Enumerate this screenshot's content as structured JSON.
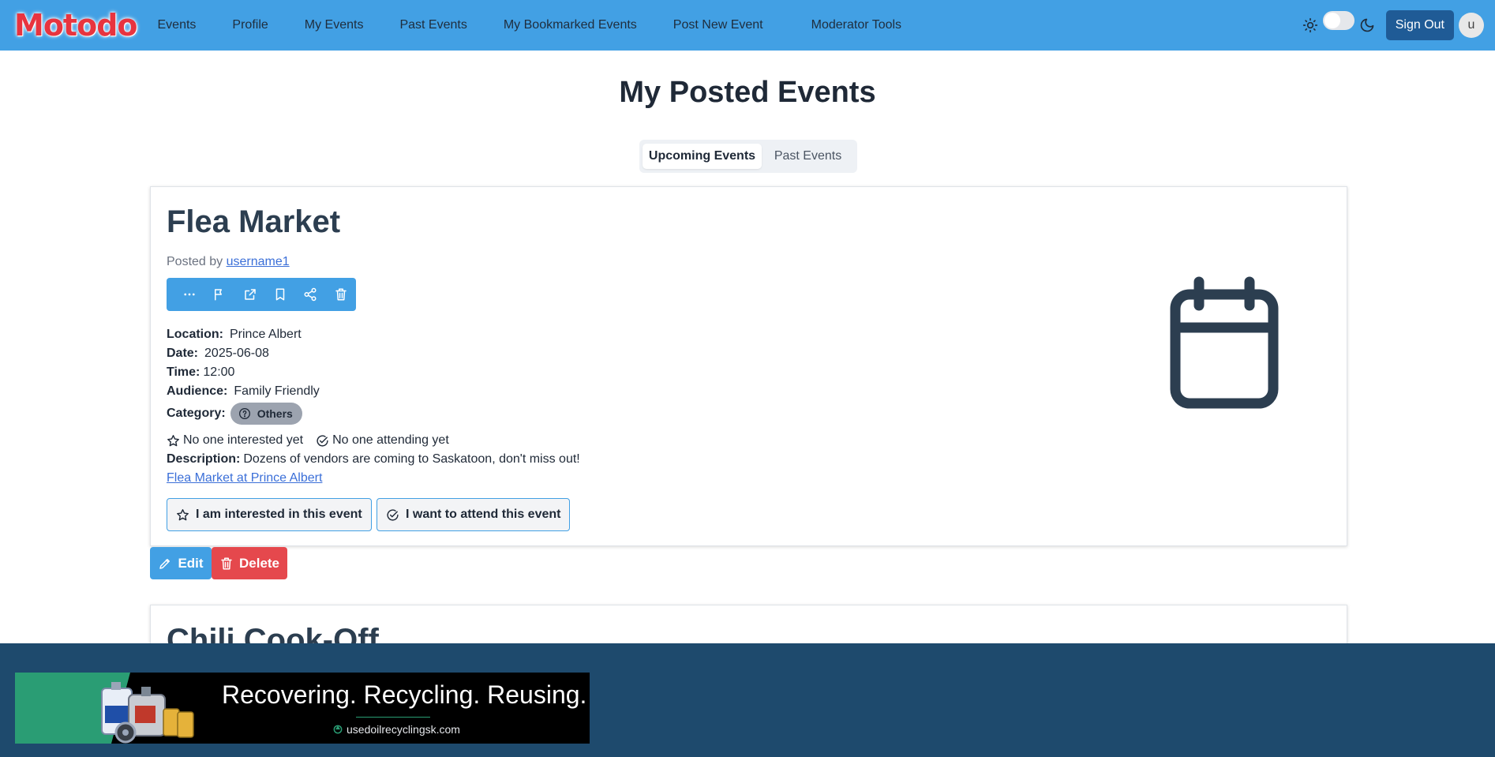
{
  "app": {
    "logo": "Motodo"
  },
  "nav": {
    "links": [
      "Events",
      "Profile",
      "My Events",
      "Past Events",
      "My Bookmarked Events",
      "Post New Event",
      "Moderator Tools"
    ],
    "sign_out": "Sign Out",
    "avatar_initial": "u",
    "theme_toggle": "light"
  },
  "page": {
    "title": "My Posted Events",
    "tabs": [
      {
        "label": "Upcoming Events",
        "active": true
      },
      {
        "label": "Past Events",
        "active": false
      }
    ]
  },
  "event": {
    "title": "Flea Market",
    "posted_by_prefix": "Posted by",
    "posted_by_user": "username1",
    "action_icons": [
      "more-icon",
      "flag-icon",
      "external-link-icon",
      "bookmark-icon",
      "share-icon",
      "trash-icon"
    ],
    "location_label": "Location:",
    "location": "Prince Albert",
    "date_label": "Date:",
    "date": "2025-06-08",
    "time_label": "Time:",
    "time": "12:00",
    "audience_label": "Audience:",
    "audience": "Family Friendly",
    "category_label": "Category:",
    "category": "Others",
    "interested_text": "No one interested yet",
    "attending_text": "No one attending yet",
    "description_label": "Description:",
    "description": "Dozens of vendors are coming to Saskatoon, don't miss out!",
    "link_text": "Flea Market at Prince Albert",
    "interested_button": "I am interested in this event",
    "attend_button": "I want to attend this event",
    "edit_button": "Edit",
    "delete_button": "Delete"
  },
  "next_event": {
    "title": "Chili Cook-Off"
  },
  "ad": {
    "headline": "Recovering. Recycling. Reusing.",
    "url": "usedoilrecyclingsk.com"
  },
  "colors": {
    "navbar": "#42a0e4",
    "logo": "#e8343f",
    "sign_out": "#1f5b96",
    "delete": "#e5484d",
    "footer": "#1e4a6d",
    "ad_green": "#2a9d74"
  }
}
